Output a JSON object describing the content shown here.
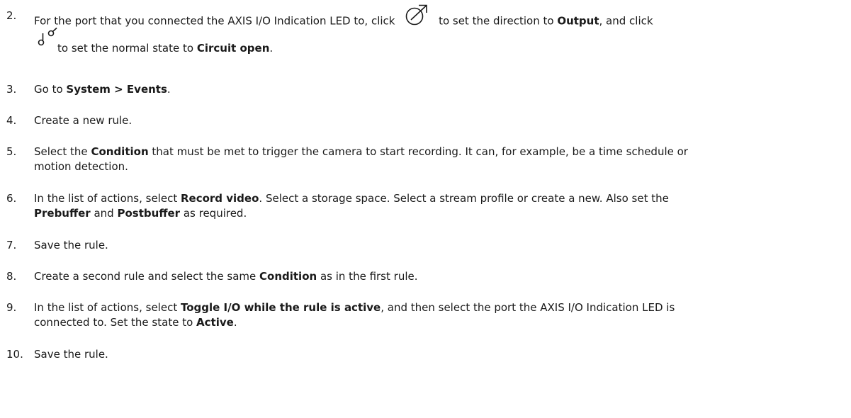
{
  "steps": [
    {
      "number": "2.",
      "line1_before": "For the port that you connected the AXIS I/O Indication LED to, click",
      "line1_mid": "to set the direction to",
      "direction_value": "Output",
      "line1_after": ", and click",
      "line2_before": "to set the normal state to",
      "state_value": "Circuit open",
      "line2_after": ".",
      "icons": [
        "output-direction-icon",
        "circuit-open-switch-icon"
      ]
    },
    {
      "number": "3.",
      "before": "Go to",
      "bold": "System > Events",
      "after": "."
    },
    {
      "number": "4.",
      "text": "Create a new rule."
    },
    {
      "number": "5.",
      "before": "Select the",
      "bold": "Condition",
      "after_line1": "that must be met to trigger the camera to start recording. It can, for example, be a time schedule or",
      "line2": "motion detection."
    },
    {
      "number": "6.",
      "before": "In the list of actions, select",
      "bold1": "Record video",
      "after_line1": ". Select a storage space. Select a stream profile or create a new. Also set the",
      "bold2": "Prebuffer",
      "and": "and",
      "bold3": "Postbuffer",
      "end": "as required."
    },
    {
      "number": "7.",
      "text": "Save the rule."
    },
    {
      "number": "8.",
      "before": "Create a second rule and select the same",
      "bold": "Condition",
      "after": "as in the first rule."
    },
    {
      "number": "9.",
      "before": "In the list of actions, select",
      "bold1": "Toggle I/O while the rule is active",
      "after_line1": ", and then select the port the AXIS I/O Indication LED is",
      "line2_before": "connected to. Set the state to",
      "bold2": "Active",
      "end": "."
    },
    {
      "number": "10.",
      "text": "Save the rule."
    }
  ]
}
